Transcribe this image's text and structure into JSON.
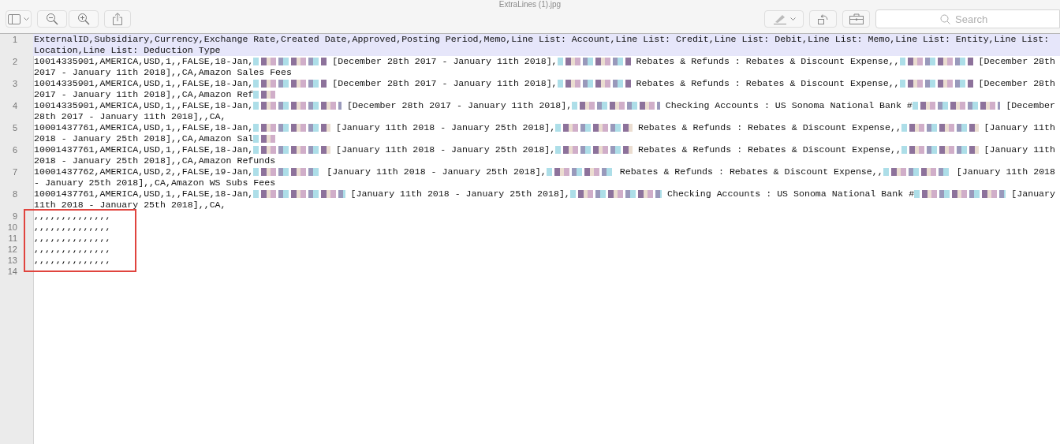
{
  "window": {
    "title": "ExtraLines (1).jpg"
  },
  "search": {
    "placeholder": "Search"
  },
  "lines": [
    {
      "number": "1",
      "selected": true,
      "boxed": false,
      "rows": [
        [
          {
            "kind": "text",
            "text": "ExternalID,Subsidiary,Currency,Exchange Rate,Created Date,Approved,Posting Period,Memo,Line List: Account,Line List: Credit,Line List: Debit,Line List: Memo,Line List: Entity,Line List:"
          }
        ],
        [
          {
            "kind": "text",
            "text": "Location,Line List: Deduction Type"
          }
        ]
      ]
    },
    {
      "number": "2",
      "selected": false,
      "boxed": false,
      "rows": [
        [
          {
            "kind": "text",
            "text": "10014335901,AMERICA,USD,1,,FALSE,18-Jan,"
          },
          {
            "kind": "blur"
          },
          {
            "kind": "text",
            "text": " [December 28th 2017 - January 11th 2018],"
          },
          {
            "kind": "blur"
          },
          {
            "kind": "text",
            "text": " Rebates & Refunds : Rebates & Discount Expense,,"
          },
          {
            "kind": "blur"
          },
          {
            "kind": "text",
            "text": " [December 28th"
          }
        ],
        [
          {
            "kind": "text",
            "text": "2017 - January 11th 2018],,CA,Amazon Sales Fees"
          }
        ]
      ]
    },
    {
      "number": "3",
      "selected": false,
      "boxed": false,
      "rows": [
        [
          {
            "kind": "text",
            "text": "10014335901,AMERICA,USD,1,,FALSE,18-Jan,"
          },
          {
            "kind": "blur"
          },
          {
            "kind": "text",
            "text": " [December 28th 2017 - January 11th 2018],"
          },
          {
            "kind": "blur"
          },
          {
            "kind": "text",
            "text": " Rebates & Refunds : Rebates & Discount Expense,,"
          },
          {
            "kind": "blur"
          },
          {
            "kind": "text",
            "text": " [December 28th"
          }
        ],
        [
          {
            "kind": "text",
            "text": "2017 - January 11th 2018],,CA,Amazon Ref"
          },
          {
            "kind": "blur"
          }
        ]
      ]
    },
    {
      "number": "4",
      "selected": false,
      "boxed": false,
      "rows": [
        [
          {
            "kind": "text",
            "text": "10014335901,AMERICA,USD,1,,FALSE,18-Jan,"
          },
          {
            "kind": "blur"
          },
          {
            "kind": "text",
            "text": " [December 28th 2017 - January 11th 2018],"
          },
          {
            "kind": "blur"
          },
          {
            "kind": "text",
            "text": " Checking Accounts : US Sonoma National Bank #"
          },
          {
            "kind": "blur"
          },
          {
            "kind": "text",
            "text": " [December"
          }
        ],
        [
          {
            "kind": "text",
            "text": "28th 2017 - January 11th 2018],,CA,"
          }
        ]
      ]
    },
    {
      "number": "5",
      "selected": false,
      "boxed": false,
      "rows": [
        [
          {
            "kind": "text",
            "text": "10001437761,AMERICA,USD,1,,FALSE,18-Jan,"
          },
          {
            "kind": "blur"
          },
          {
            "kind": "text",
            "text": " [January 11th 2018 - January 25th 2018],"
          },
          {
            "kind": "blur"
          },
          {
            "kind": "text",
            "text": " Rebates & Refunds : Rebates & Discount Expense,,"
          },
          {
            "kind": "blur"
          },
          {
            "kind": "text",
            "text": " [January 11th"
          }
        ],
        [
          {
            "kind": "text",
            "text": "2018 - January 25th 2018],,CA,Amazon Sal"
          },
          {
            "kind": "blur"
          }
        ]
      ]
    },
    {
      "number": "6",
      "selected": false,
      "boxed": false,
      "rows": [
        [
          {
            "kind": "text",
            "text": "10001437761,AMERICA,USD,1,,FALSE,18-Jan,"
          },
          {
            "kind": "blur"
          },
          {
            "kind": "text",
            "text": " [January 11th 2018 - January 25th 2018],"
          },
          {
            "kind": "blur"
          },
          {
            "kind": "text",
            "text": " Rebates & Refunds : Rebates & Discount Expense,,"
          },
          {
            "kind": "blur"
          },
          {
            "kind": "text",
            "text": " [January 11th"
          }
        ],
        [
          {
            "kind": "text",
            "text": "2018 - January 25th 2018],,CA,Amazon Refunds"
          }
        ]
      ]
    },
    {
      "number": "7",
      "selected": false,
      "boxed": false,
      "rows": [
        [
          {
            "kind": "text",
            "text": "10001437762,AMERICA,USD,2,,FALSE,19-Jan,"
          },
          {
            "kind": "blur"
          },
          {
            "kind": "text",
            "text": " [January 11th 2018 - January 25th 2018],"
          },
          {
            "kind": "blur"
          },
          {
            "kind": "text",
            "text": " Rebates & Refunds : Rebates & Discount Expense,,"
          },
          {
            "kind": "blur"
          },
          {
            "kind": "text",
            "text": " [January 11th 2018"
          }
        ],
        [
          {
            "kind": "text",
            "text": "- January 25th 2018],,CA,Amazon WS Subs Fees"
          }
        ]
      ]
    },
    {
      "number": "8",
      "selected": false,
      "boxed": false,
      "rows": [
        [
          {
            "kind": "text",
            "text": "10001437761,AMERICA,USD,1,,FALSE,18-Jan,"
          },
          {
            "kind": "blur"
          },
          {
            "kind": "text",
            "text": " [January 11th 2018 - January 25th 2018],"
          },
          {
            "kind": "blur"
          },
          {
            "kind": "text",
            "text": " Checking Accounts : US Sonoma National Bank #"
          },
          {
            "kind": "blur"
          },
          {
            "kind": "text",
            "text": " [January"
          }
        ],
        [
          {
            "kind": "text",
            "text": "11th 2018 - January 25th 2018],,CA,"
          }
        ]
      ]
    },
    {
      "number": "9",
      "selected": false,
      "boxed": true,
      "rows": [
        [
          {
            "kind": "text",
            "text": ",,,,,,,,,,,,,,"
          }
        ]
      ]
    },
    {
      "number": "10",
      "selected": false,
      "boxed": true,
      "rows": [
        [
          {
            "kind": "text",
            "text": ",,,,,,,,,,,,,,"
          }
        ]
      ]
    },
    {
      "number": "11",
      "selected": false,
      "boxed": true,
      "rows": [
        [
          {
            "kind": "text",
            "text": ",,,,,,,,,,,,,,"
          }
        ]
      ]
    },
    {
      "number": "12",
      "selected": false,
      "boxed": true,
      "rows": [
        [
          {
            "kind": "text",
            "text": ",,,,,,,,,,,,,,"
          }
        ]
      ]
    },
    {
      "number": "13",
      "selected": false,
      "boxed": true,
      "rows": [
        [
          {
            "kind": "text",
            "text": ",,,,,,,,,,,,,,"
          }
        ]
      ]
    },
    {
      "number": "14",
      "selected": false,
      "boxed": false
    }
  ]
}
